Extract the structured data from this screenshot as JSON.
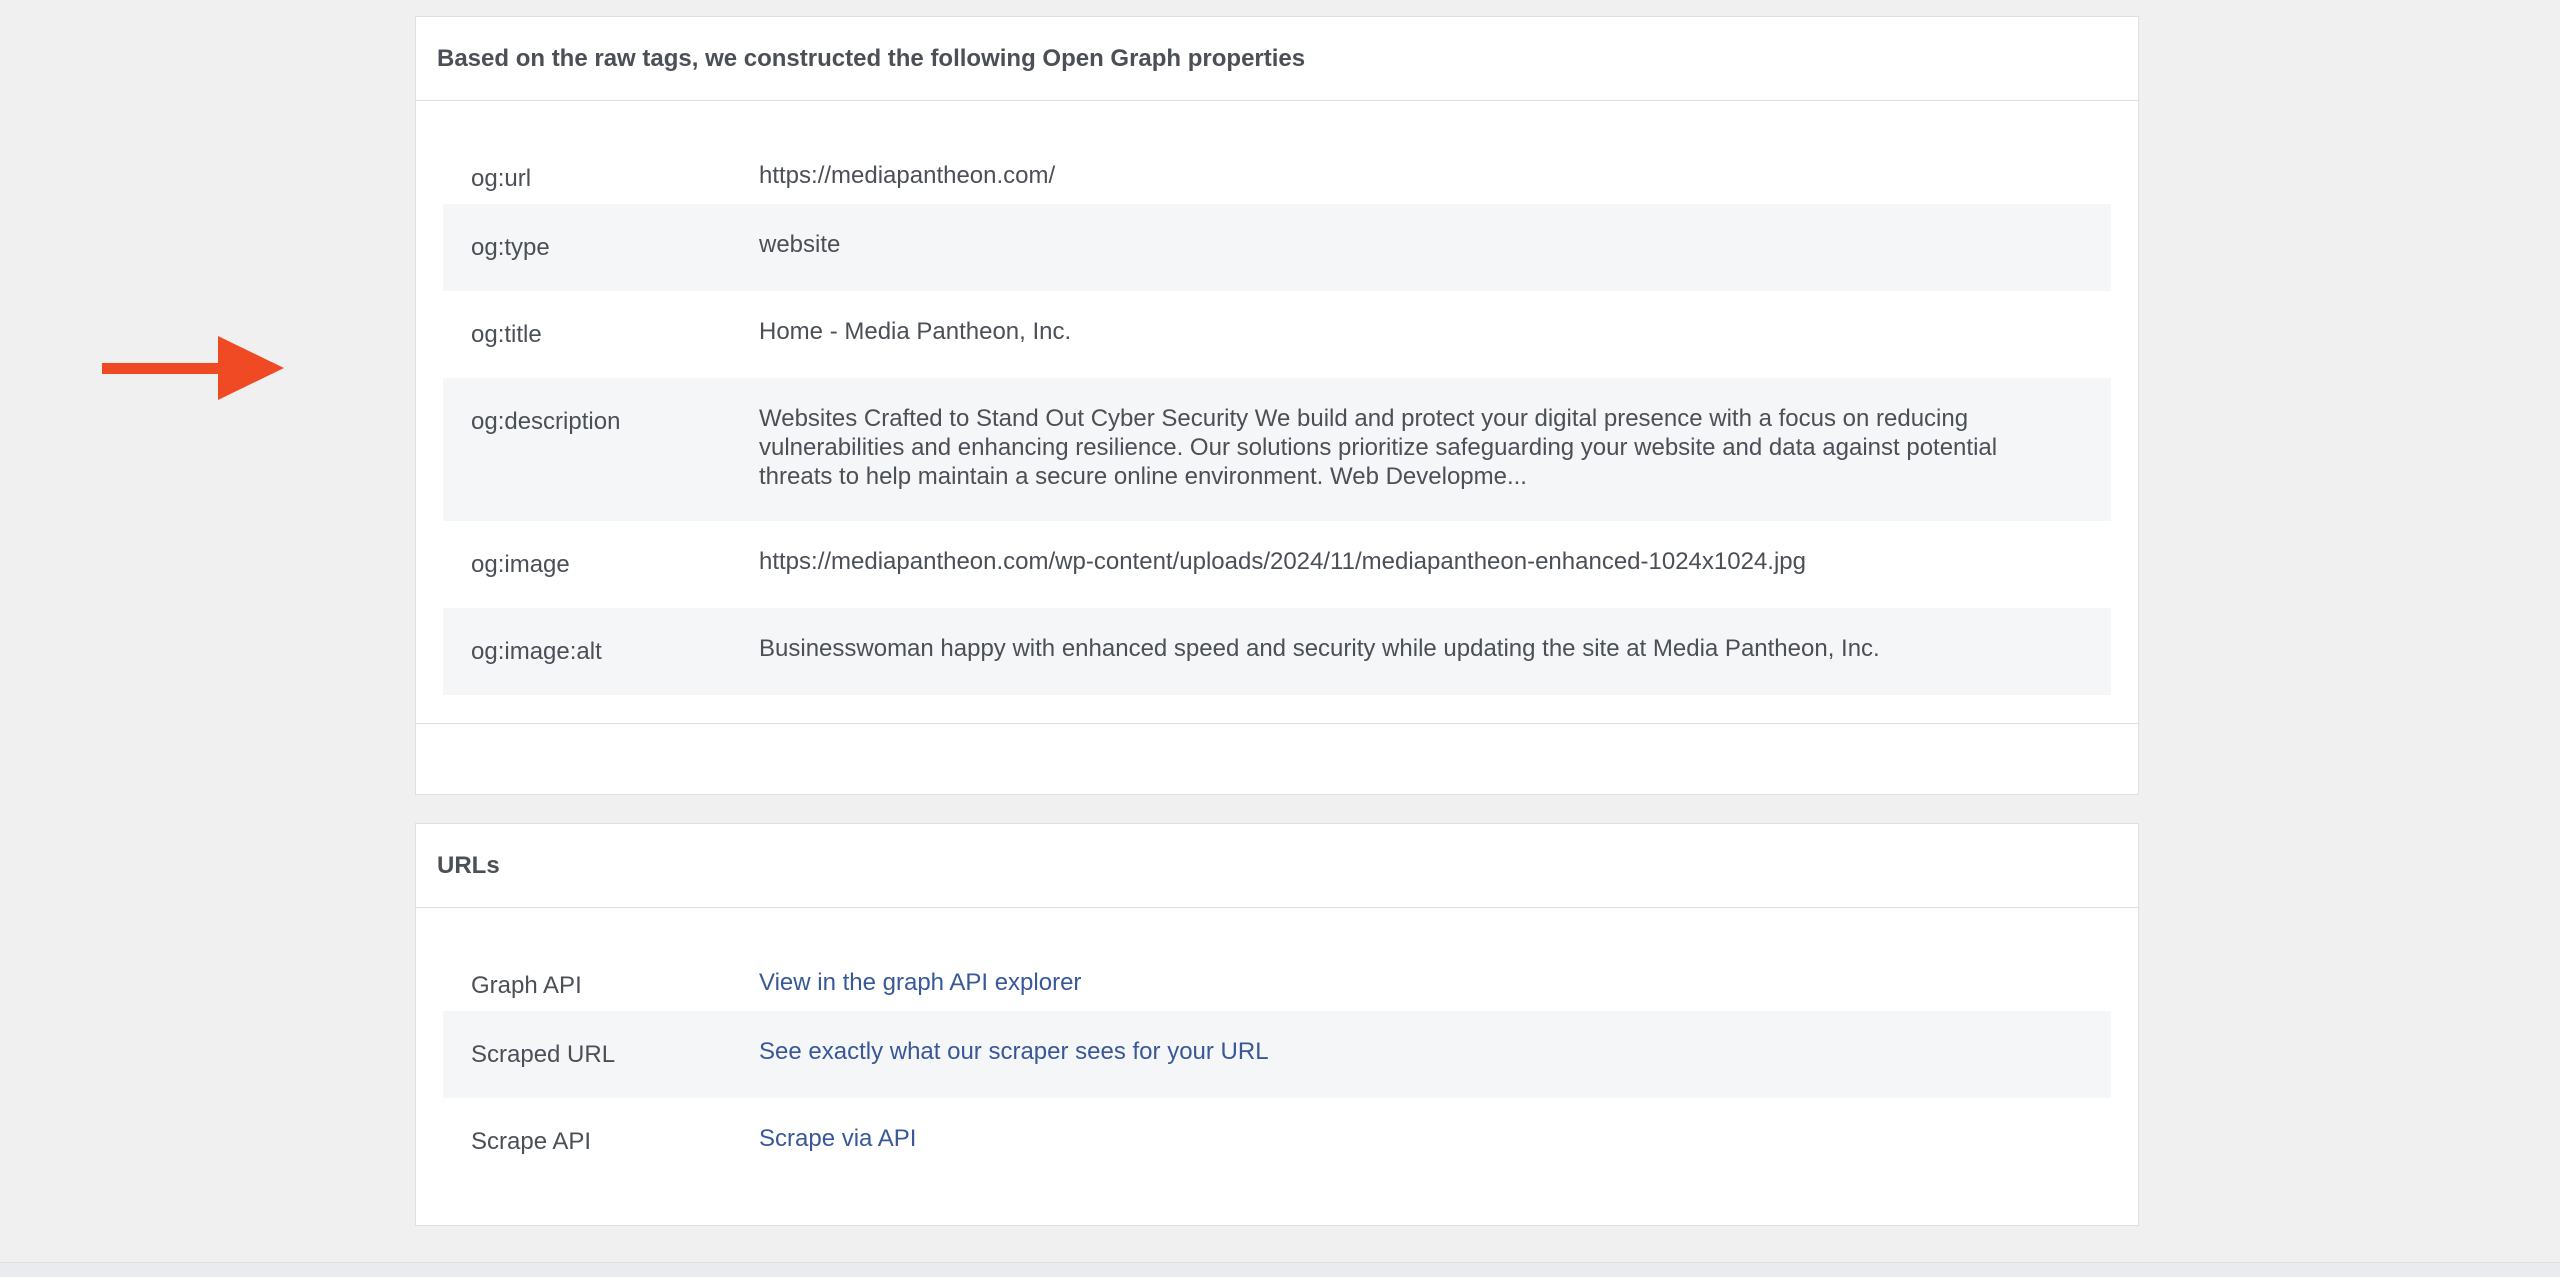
{
  "colors": {
    "arrow": "#ef4a23",
    "link": "#385898",
    "text": "#4b4f56",
    "row_alt": "#f5f6f7",
    "border": "#dddfe2"
  },
  "og_panel": {
    "title": "Based on the raw tags, we constructed the following Open Graph properties",
    "rows": [
      {
        "key": "og:url",
        "value": "https://mediapantheon.com/"
      },
      {
        "key": "og:type",
        "value": "website"
      },
      {
        "key": "og:title",
        "value": "Home - Media Pantheon, Inc."
      },
      {
        "key": "og:description",
        "value": "Websites Crafted to Stand Out Cyber Security We build and protect your digital presence with a focus on reducing vulnerabilities and enhancing resilience. Our solutions prioritize safeguarding your website and data against potential threats to help maintain a secure online environment. Web Developme..."
      },
      {
        "key": "og:image",
        "value": "https://mediapantheon.com/wp-content/uploads/2024/11/mediapantheon-enhanced-1024x1024.jpg"
      },
      {
        "key": "og:image:alt",
        "value": "Businesswoman happy with enhanced speed and security while updating the site at Media Pantheon, Inc."
      }
    ]
  },
  "urls_panel": {
    "title": "URLs",
    "rows": [
      {
        "key": "Graph API",
        "link": "View in the graph API explorer"
      },
      {
        "key": "Scraped URL",
        "link": "See exactly what our scraper sees for your URL"
      },
      {
        "key": "Scrape API",
        "link": "Scrape via API"
      }
    ]
  },
  "icons": {
    "annotation": "arrow-right-icon"
  }
}
